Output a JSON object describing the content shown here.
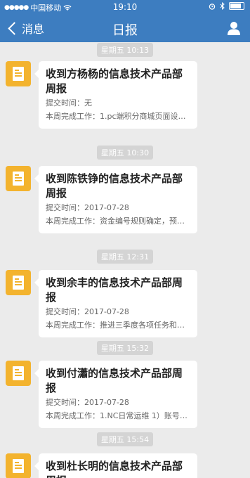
{
  "status": {
    "carrier": "中国移动",
    "time": "19:10"
  },
  "nav": {
    "back_label": "消息",
    "title": "日报"
  },
  "messages": [
    {
      "timestamp": "星期五 10:13",
      "title": "收到方杨杨的信息技术产品部周报",
      "submit_time": "提交时间：无",
      "summary": "本周完成工作：1.pc端积分商城页面设计…"
    },
    {
      "timestamp": "星期五 10:30",
      "title": "收到陈铁铮的信息技术产品部周报",
      "submit_time": "提交时间：2017-07-28",
      "summary": "本周完成工作：资金编号规则确定，预…"
    },
    {
      "timestamp": "星期五 12:31",
      "title": "收到余丰的信息技术产品部周报",
      "submit_time": "提交时间：2017-07-28",
      "summary": "本周完成工作：推进三季度各项任务和…"
    },
    {
      "timestamp": "星期五 15:32",
      "title": "收到付瀟的信息技术产品部周报",
      "submit_time": "提交时间：2017-07-28",
      "summary": "本周完成工作：1.NC日常运维 1）账号…"
    },
    {
      "timestamp": "星期五 15:54",
      "title": "收到杜长明的信息技术产品部周报",
      "submit_time": "",
      "summary": ""
    }
  ]
}
